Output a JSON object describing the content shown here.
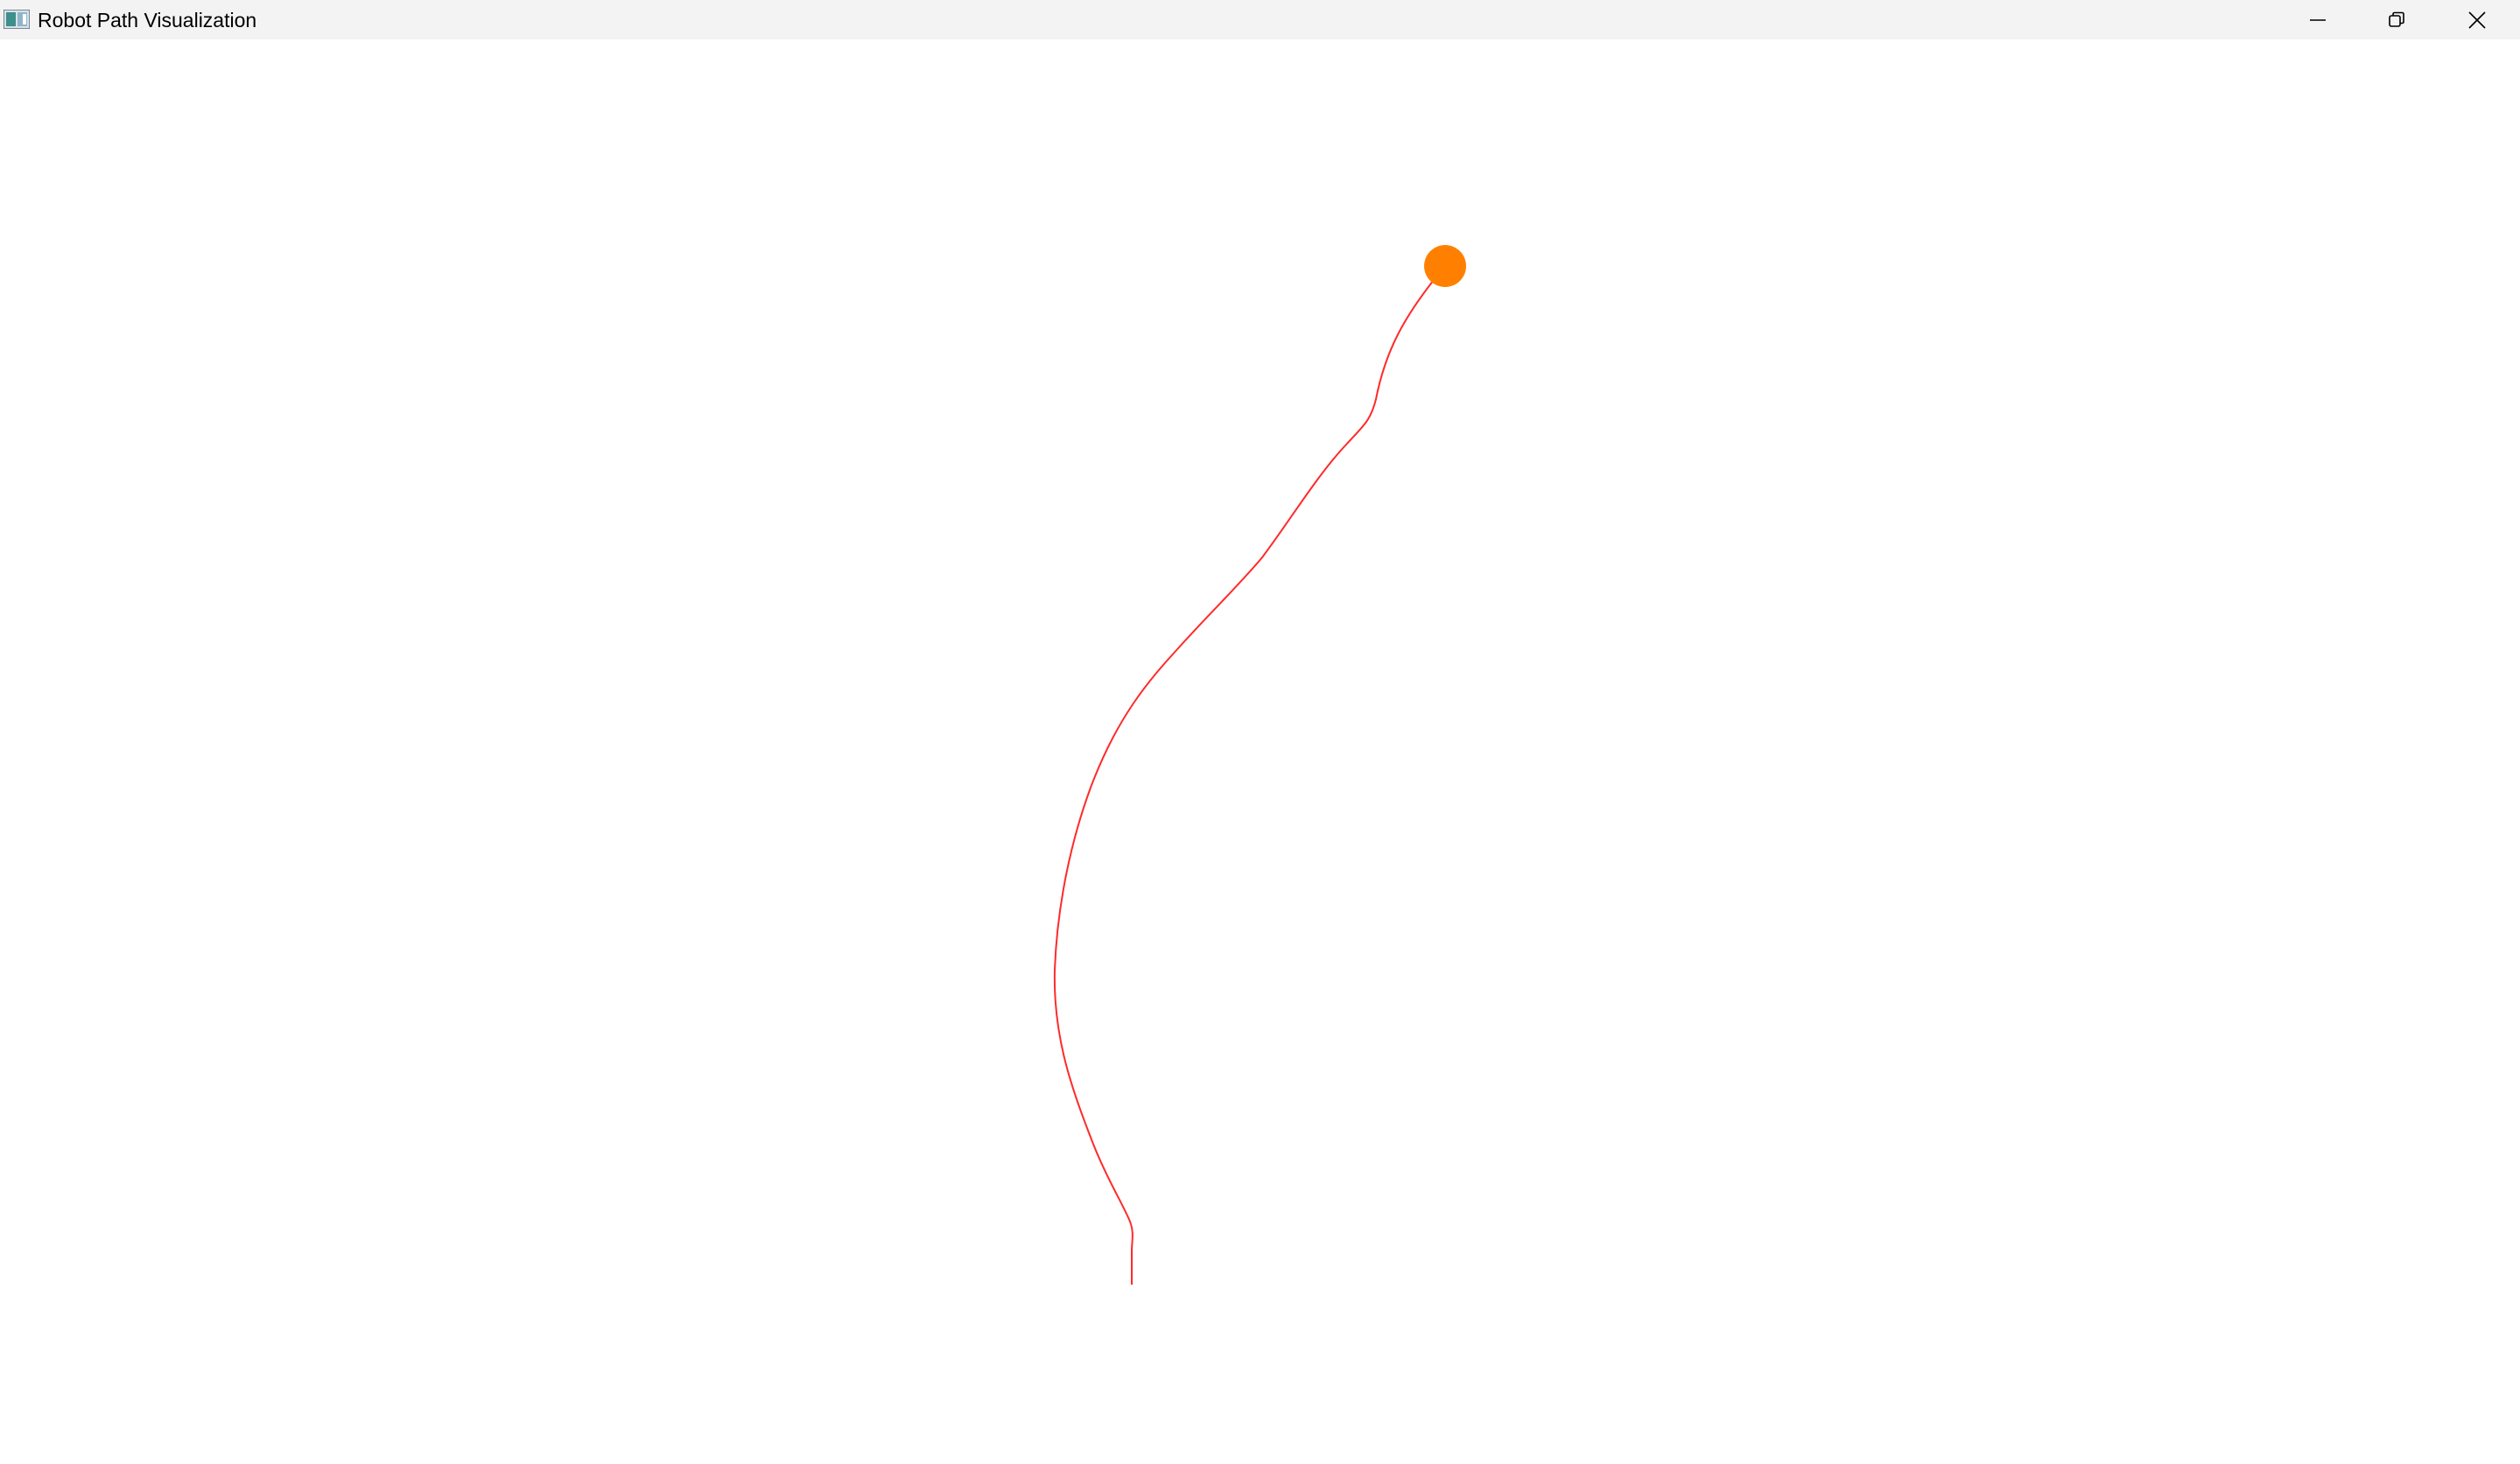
{
  "window": {
    "title": "Robot Path Visualization"
  },
  "controls": {
    "minimize_icon": "minimize-icon",
    "maximize_icon": "restore-icon",
    "close_icon": "close-icon"
  },
  "visualization": {
    "path_color": "#ff2a2a",
    "robot_color": "#ff8000",
    "background_color": "#ffffff"
  }
}
